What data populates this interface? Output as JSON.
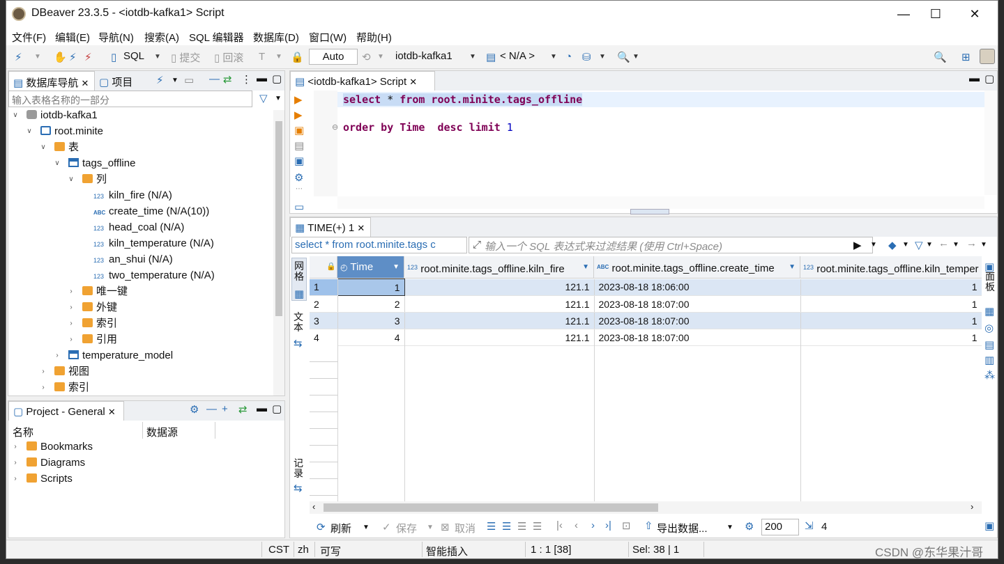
{
  "window": {
    "title": "DBeaver 23.3.5 - <iotdb-kafka1> Script",
    "minimize": "—",
    "maximize": "☐",
    "close": "✕"
  },
  "menu": [
    "文件(F)",
    "编辑(E)",
    "导航(N)",
    "搜索(A)",
    "SQL 编辑器",
    "数据库(D)",
    "窗口(W)",
    "帮助(H)"
  ],
  "toolbar": {
    "sql_label": "SQL",
    "commit": "提交",
    "rollback": "回滚",
    "mode": "Auto",
    "connection": "iotdb-kafka1",
    "schema": "< N/A >"
  },
  "navigator": {
    "tab_label": "数据库导航",
    "project_tab_label": "项目",
    "filter_placeholder": "输入表格名称的一部分",
    "tree": [
      {
        "label": "iotdb-kafka1"
      },
      {
        "label": "root.minite"
      },
      {
        "label": "表"
      },
      {
        "label": "tags_offline"
      },
      {
        "label": "列"
      },
      {
        "label": "kiln_fire (N/A)"
      },
      {
        "label": "create_time (N/A(10))"
      },
      {
        "label": "head_coal (N/A)"
      },
      {
        "label": "kiln_temperature (N/A)"
      },
      {
        "label": "an_shui (N/A)"
      },
      {
        "label": "two_temperature (N/A)"
      },
      {
        "label": "唯一键"
      },
      {
        "label": "外键"
      },
      {
        "label": "索引"
      },
      {
        "label": "引用"
      },
      {
        "label": "temperature_model"
      },
      {
        "label": "视图"
      },
      {
        "label": "索引"
      }
    ]
  },
  "project": {
    "tab_label": "Project - General",
    "col_name": "名称",
    "col_source": "数据源",
    "items": [
      "Bookmarks",
      "Diagrams",
      "Scripts"
    ]
  },
  "editor": {
    "tab_label": "<iotdb-kafka1> Script",
    "line1": {
      "select": "select",
      "star": " * ",
      "from": "from",
      "target": " root.minite.tags_offline"
    },
    "line2": {
      "order": "order by",
      "col": " Time  ",
      "desc": "desc limit",
      "num": " 1"
    }
  },
  "results": {
    "tab_label": "TIME(+) 1",
    "query_preview": "select * from root.minite.tags c",
    "filter_placeholder": "输入一个 SQL 表达式来过滤结果 (使用 Ctrl+Space)",
    "side_grid": "网格",
    "side_text": "文本",
    "side_record": "记录",
    "side_panel": "面板",
    "columns": [
      "Time",
      "root.minite.tags_offline.kiln_fire",
      "root.minite.tags_offline.create_time",
      "root.minite.tags_offline.kiln_temper"
    ],
    "col_types": [
      "clock",
      "123",
      "ABC",
      "123"
    ],
    "rows": [
      {
        "n": "1",
        "time": "1",
        "kiln_fire": "121.1",
        "create_time": "2023-08-18 18:06:00",
        "kiln_temp": "1"
      },
      {
        "n": "2",
        "time": "2",
        "kiln_fire": "121.1",
        "create_time": "2023-08-18 18:07:00",
        "kiln_temp": "1"
      },
      {
        "n": "3",
        "time": "3",
        "kiln_fire": "121.1",
        "create_time": "2023-08-18 18:07:00",
        "kiln_temp": "1"
      },
      {
        "n": "4",
        "time": "4",
        "kiln_fire": "121.1",
        "create_time": "2023-08-18 18:07:00",
        "kiln_temp": "1"
      }
    ],
    "bottom": {
      "refresh": "刷新",
      "save": "保存",
      "cancel": "取消",
      "export": "导出数据...",
      "fetch_size": "200",
      "row_count": "4"
    }
  },
  "status": {
    "tz": "CST",
    "locale": "zh",
    "mode": "可写",
    "insert": "智能插入",
    "pos": "1 : 1 [38]",
    "sel": "Sel: 38 | 1"
  },
  "watermark": "CSDN @东华果汁哥"
}
